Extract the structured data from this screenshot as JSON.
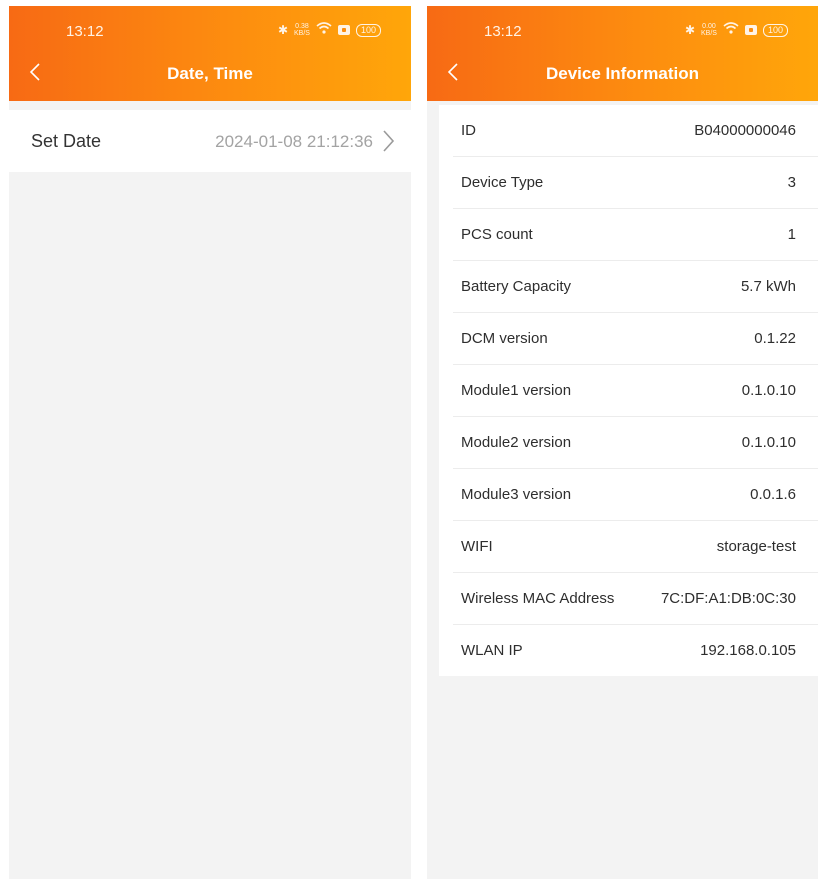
{
  "left": {
    "status": {
      "time": "13:12",
      "speed": "0.38\nKB/S",
      "battery": "100"
    },
    "title": "Date, Time",
    "set_date": {
      "label": "Set Date",
      "value": "2024-01-08 21:12:36"
    }
  },
  "right": {
    "status": {
      "time": "13:12",
      "speed": "0.00\nKB/S",
      "battery": "100"
    },
    "title": "Device Information",
    "rows": [
      {
        "label": "ID",
        "value": "B04000000046"
      },
      {
        "label": "Device Type",
        "value": "3"
      },
      {
        "label": "PCS count",
        "value": "1"
      },
      {
        "label": "Battery Capacity",
        "value": "5.7 kWh"
      },
      {
        "label": "DCM version",
        "value": "0.1.22"
      },
      {
        "label": "Module1 version",
        "value": "0.1.0.10"
      },
      {
        "label": "Module2 version",
        "value": "0.1.0.10"
      },
      {
        "label": "Module3 version",
        "value": "0.0.1.6"
      },
      {
        "label": "WIFI",
        "value": "storage-test"
      },
      {
        "label": "Wireless MAC Address",
        "value": "7C:DF:A1:DB:0C:30"
      },
      {
        "label": "WLAN IP",
        "value": "192.168.0.105"
      }
    ]
  },
  "colors": {
    "header_start": "#f76a14",
    "header_end": "#ffa60a",
    "background": "#f3f3f3"
  }
}
